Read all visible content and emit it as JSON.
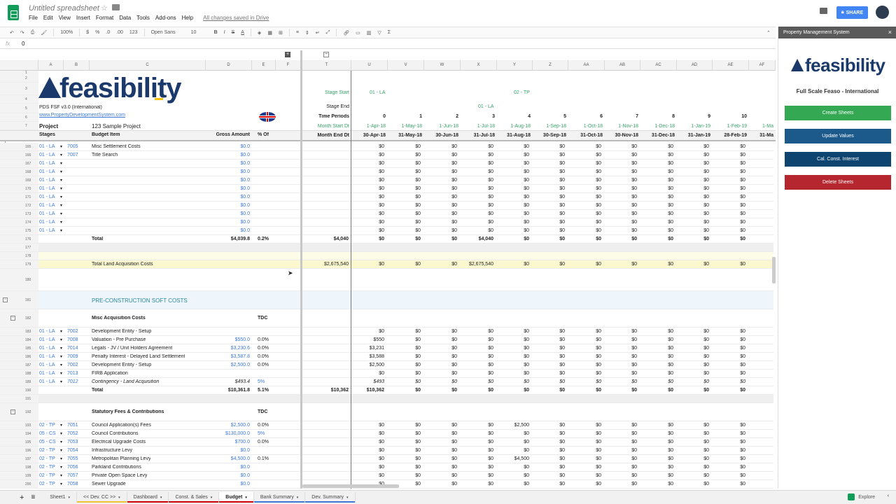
{
  "app": {
    "title": "Untitled spreadsheet",
    "menus": [
      "File",
      "Edit",
      "View",
      "Insert",
      "Format",
      "Data",
      "Tools",
      "Add-ons",
      "Help"
    ],
    "saved": "All changes saved in Drive",
    "share": "SHARE"
  },
  "toolbar": {
    "zoom": "100%",
    "currency": "$",
    "percent": "%",
    "dec_less": ".0",
    "dec_more": ".00",
    "format": "123",
    "font": "Open Sans",
    "size": "10",
    "bold": "B",
    "italic": "I",
    "strike": "S",
    "text_color": "A",
    "sigma": "Σ"
  },
  "formula": {
    "fx": "fx",
    "value": "0"
  },
  "columns": {
    "A": "A",
    "B": "B",
    "C": "C",
    "D": "D",
    "E": "E",
    "F": "F",
    "T": "T",
    "U": "U",
    "V": "V",
    "W": "W",
    "X": "X",
    "Y": "Y",
    "Z": "Z",
    "AA": "AA",
    "AB": "AB",
    "AC": "AC",
    "AD": "AD",
    "AE": "AE",
    "AF": "AF"
  },
  "header": {
    "logo": "feasibility",
    "version": "PDS FSF v3.0 (International)",
    "website": "www.PropertyDevelopmentSystem.com",
    "project_label": "Project",
    "project_value": "123 Sample Project",
    "stages": "Stages",
    "budget_item": "Budget Item",
    "gross_amount": "Gross Amount",
    "pct_of": "% Of",
    "stage_start": "Stage Start",
    "stage_end": "Stage End",
    "time_periods": "Time Periods",
    "month_start": "Month Start Dt",
    "month_end": "Month End Dt",
    "stage_start_la": "01 - LA",
    "stage_start_tp": "02 - TP",
    "stage_end_la": "01 - LA",
    "periods": [
      "0",
      "1",
      "2",
      "3",
      "4",
      "5",
      "6",
      "7",
      "8",
      "9",
      "10"
    ],
    "starts": [
      "1-Apr-18",
      "1-May-18",
      "1-Jun-18",
      "1-Jul-18",
      "1-Aug-18",
      "1-Sep-18",
      "1-Oct-18",
      "1-Nov-18",
      "1-Dec-18",
      "1-Jan-19",
      "1-Feb-19",
      "1-Ma"
    ],
    "ends": [
      "30-Apr-18",
      "31-May-18",
      "30-Jun-18",
      "31-Jul-18",
      "31-Aug-18",
      "30-Sep-18",
      "31-Oct-18",
      "30-Nov-18",
      "31-Dec-18",
      "31-Jan-19",
      "28-Feb-19",
      "31-Ma"
    ],
    "row_nums": [
      "1",
      "2",
      "3",
      "4",
      "5",
      "6",
      "7"
    ]
  },
  "rows": [
    {
      "n": "165",
      "stage": "01 - LA",
      "code": "7005",
      "item": "Misc Settlement Costs",
      "gross": "$0.0",
      "pct": "",
      "t": "",
      "vals": [
        "$0",
        "$0",
        "$0",
        "$0",
        "$0",
        "$0",
        "$0",
        "$0",
        "$0",
        "$0",
        "$0"
      ]
    },
    {
      "n": "166",
      "stage": "01 - LA",
      "code": "7007",
      "item": "Title Search",
      "gross": "$0.0",
      "pct": "",
      "t": "",
      "vals": [
        "$0",
        "$0",
        "$0",
        "$0",
        "$0",
        "$0",
        "$0",
        "$0",
        "$0",
        "$0",
        "$0"
      ]
    },
    {
      "n": "167",
      "stage": "01 - LA",
      "code": "",
      "item": "",
      "gross": "$0.0",
      "pct": "",
      "t": "",
      "vals": [
        "$0",
        "$0",
        "$0",
        "$0",
        "$0",
        "$0",
        "$0",
        "$0",
        "$0",
        "$0",
        "$0"
      ]
    },
    {
      "n": "168",
      "stage": "01 - LA",
      "code": "",
      "item": "",
      "gross": "$0.0",
      "pct": "",
      "t": "",
      "vals": [
        "$0",
        "$0",
        "$0",
        "$0",
        "$0",
        "$0",
        "$0",
        "$0",
        "$0",
        "$0",
        "$0"
      ]
    },
    {
      "n": "169",
      "stage": "01 - LA",
      "code": "",
      "item": "",
      "gross": "$0.0",
      "pct": "",
      "t": "",
      "vals": [
        "$0",
        "$0",
        "$0",
        "$0",
        "$0",
        "$0",
        "$0",
        "$0",
        "$0",
        "$0",
        "$0"
      ]
    },
    {
      "n": "170",
      "stage": "01 - LA",
      "code": "",
      "item": "",
      "gross": "$0.0",
      "pct": "",
      "t": "",
      "vals": [
        "$0",
        "$0",
        "$0",
        "$0",
        "$0",
        "$0",
        "$0",
        "$0",
        "$0",
        "$0",
        "$0"
      ]
    },
    {
      "n": "171",
      "stage": "01 - LA",
      "code": "",
      "item": "",
      "gross": "$0.0",
      "pct": "",
      "t": "",
      "vals": [
        "$0",
        "$0",
        "$0",
        "$0",
        "$0",
        "$0",
        "$0",
        "$0",
        "$0",
        "$0",
        "$0"
      ]
    },
    {
      "n": "172",
      "stage": "01 - LA",
      "code": "",
      "item": "",
      "gross": "$0.0",
      "pct": "",
      "t": "",
      "vals": [
        "$0",
        "$0",
        "$0",
        "$0",
        "$0",
        "$0",
        "$0",
        "$0",
        "$0",
        "$0",
        "$0"
      ]
    },
    {
      "n": "173",
      "stage": "01 - LA",
      "code": "",
      "item": "",
      "gross": "$0.0",
      "pct": "",
      "t": "",
      "vals": [
        "$0",
        "$0",
        "$0",
        "$0",
        "$0",
        "$0",
        "$0",
        "$0",
        "$0",
        "$0",
        "$0"
      ]
    },
    {
      "n": "174",
      "stage": "01 - LA",
      "code": "",
      "item": "",
      "gross": "$0.0",
      "pct": "",
      "t": "",
      "vals": [
        "$0",
        "$0",
        "$0",
        "$0",
        "$0",
        "$0",
        "$0",
        "$0",
        "$0",
        "$0",
        "$0"
      ]
    },
    {
      "n": "175",
      "stage": "01 - LA",
      "code": "",
      "item": "",
      "gross": "$0.0",
      "pct": "",
      "t": "",
      "vals": [
        "$0",
        "$0",
        "$0",
        "$0",
        "$0",
        "$0",
        "$0",
        "$0",
        "$0",
        "$0",
        "$0"
      ]
    },
    {
      "n": "176",
      "stage": "",
      "code": "",
      "item": "Total",
      "gross": "$4,039.8",
      "pct": "0.2%",
      "t": "$4,040",
      "vals": [
        "$0",
        "$0",
        "$0",
        "$4,040",
        "$0",
        "$0",
        "$0",
        "$0",
        "$0",
        "$0",
        "$0"
      ],
      "bold": true
    },
    {
      "n": "177",
      "stage": "",
      "code": "",
      "item": "",
      "gross": "",
      "pct": "",
      "t": "",
      "vals": [],
      "shade": "#efefef"
    },
    {
      "n": "178",
      "stage": "",
      "code": "",
      "item": "",
      "gross": "",
      "pct": "",
      "t": "",
      "vals": [],
      "shade": "#fdfde7"
    },
    {
      "n": "179",
      "stage": "",
      "code": "",
      "item": "Total Land Acquisition Costs",
      "gross": "",
      "pct": "",
      "t": "$2,675,540",
      "vals": [
        "$0",
        "$0",
        "$0",
        "$2,675,540",
        "$0",
        "$0",
        "$0",
        "$0",
        "$0",
        "$0",
        "$0"
      ],
      "shade": "#fbf8d0"
    },
    {
      "n": "180",
      "stage": "",
      "code": "",
      "item": "",
      "gross": "",
      "pct": "",
      "t": "",
      "vals": [],
      "h": 32
    },
    {
      "n": "181",
      "stage": "",
      "code": "",
      "item": "PRE-CONSTRUCTION SOFT COSTS",
      "gross": "",
      "pct": "",
      "t": "",
      "vals": [],
      "h": 26,
      "shade": "#eef5fb",
      "teal": true
    },
    {
      "n": "182",
      "stage": "",
      "code": "",
      "item": "Misc Acquisition Costs",
      "gross": "",
      "pct": "TDC",
      "t": "",
      "vals": [],
      "h": 26,
      "bold": true
    },
    {
      "n": "183",
      "stage": "01 - LA",
      "code": "7002",
      "item": "Development Entity - Setup",
      "gross": "",
      "pct": "",
      "t": "",
      "vals": [
        "$0",
        "$0",
        "$0",
        "$0",
        "$0",
        "$0",
        "$0",
        "$0",
        "$0",
        "$0",
        "$0"
      ]
    },
    {
      "n": "184",
      "stage": "01 - LA",
      "code": "7008",
      "item": "Valuation - Pre Purchase",
      "gross": "$550.0",
      "pct": "0.0%",
      "t": "",
      "vals": [
        "$550",
        "$0",
        "$0",
        "$0",
        "$0",
        "$0",
        "$0",
        "$0",
        "$0",
        "$0",
        "$0"
      ]
    },
    {
      "n": "185",
      "stage": "01 - LA",
      "code": "7014",
      "item": "Legals - JV / Unit Holders Agreement",
      "gross": "$3,230.6",
      "pct": "0.0%",
      "t": "",
      "vals": [
        "$3,231",
        "$0",
        "$0",
        "$0",
        "$0",
        "$0",
        "$0",
        "$0",
        "$0",
        "$0",
        "$0"
      ]
    },
    {
      "n": "186",
      "stage": "01 - LA",
      "code": "7009",
      "item": "Penalty Interest - Delayed Land Settlement",
      "gross": "$3,587.8",
      "pct": "0.0%",
      "t": "",
      "vals": [
        "$3,588",
        "$0",
        "$0",
        "$0",
        "$0",
        "$0",
        "$0",
        "$0",
        "$0",
        "$0",
        "$0"
      ]
    },
    {
      "n": "187",
      "stage": "01 - LA",
      "code": "7002",
      "item": "Development Entity - Setup",
      "gross": "$2,500.0",
      "pct": "0.0%",
      "t": "",
      "vals": [
        "$2,500",
        "$0",
        "$0",
        "$0",
        "$0",
        "$0",
        "$0",
        "$0",
        "$0",
        "$0",
        "$0"
      ]
    },
    {
      "n": "188",
      "stage": "01 - LA",
      "code": "7013",
      "item": "FIRB Application",
      "gross": "",
      "pct": "",
      "t": "",
      "vals": [
        "$0",
        "$0",
        "$0",
        "$0",
        "$0",
        "$0",
        "$0",
        "$0",
        "$0",
        "$0",
        "$0"
      ]
    },
    {
      "n": "189",
      "stage": "01 - LA",
      "code": "7012",
      "item": "Contingency - Land Acquisition",
      "gross": "$493.4",
      "pct": "5%",
      "t": "",
      "vals": [
        "$493",
        "$0",
        "$0",
        "$0",
        "$0",
        "$0",
        "$0",
        "$0",
        "$0",
        "$0",
        "$0"
      ],
      "italic": true
    },
    {
      "n": "190",
      "stage": "",
      "code": "",
      "item": "Total",
      "gross": "$10,361.8",
      "pct": "5.1%",
      "t": "$10,362",
      "vals": [
        "$10,362",
        "$0",
        "$0",
        "$0",
        "$0",
        "$0",
        "$0",
        "$0",
        "$0",
        "$0",
        "$0"
      ],
      "bold": true
    },
    {
      "n": "191",
      "stage": "",
      "code": "",
      "item": "",
      "gross": "",
      "pct": "",
      "t": "",
      "vals": [],
      "shade": "#efefef"
    },
    {
      "n": "192",
      "stage": "",
      "code": "",
      "item": "Statutory Fees & Contributions",
      "gross": "",
      "pct": "TDC",
      "t": "",
      "vals": [],
      "h": 26,
      "bold": true
    },
    {
      "n": "193",
      "stage": "02 - TP",
      "code": "7051",
      "item": "Council Application(s) Fees",
      "gross": "$2,500.0",
      "pct": "0.0%",
      "t": "",
      "vals": [
        "$0",
        "$0",
        "$0",
        "$0",
        "$2,500",
        "$0",
        "$0",
        "$0",
        "$0",
        "$0",
        "$0"
      ]
    },
    {
      "n": "194",
      "stage": "05 - CS",
      "code": "7052",
      "item": "Council Contributions",
      "gross": "$130,000.0",
      "pct": "5%",
      "t": "",
      "vals": [
        "$0",
        "$0",
        "$0",
        "$0",
        "$0",
        "$0",
        "$0",
        "$0",
        "$0",
        "$0",
        "$0"
      ]
    },
    {
      "n": "195",
      "stage": "05 - CS",
      "code": "7053",
      "item": "Electrical Upgrade Costs",
      "gross": "$700.0",
      "pct": "0.0%",
      "t": "",
      "vals": [
        "$0",
        "$0",
        "$0",
        "$0",
        "$0",
        "$0",
        "$0",
        "$0",
        "$0",
        "$0",
        "$0"
      ]
    },
    {
      "n": "196",
      "stage": "02 - TP",
      "code": "7054",
      "item": "Infrastructure Levy",
      "gross": "$0.0",
      "pct": "",
      "t": "",
      "vals": [
        "$0",
        "$0",
        "$0",
        "$0",
        "$0",
        "$0",
        "$0",
        "$0",
        "$0",
        "$0",
        "$0"
      ]
    },
    {
      "n": "197",
      "stage": "02 - TP",
      "code": "7055",
      "item": "Metropolitan Planning Levy",
      "gross": "$4,500.0",
      "pct": "0.1%",
      "t": "",
      "vals": [
        "$0",
        "$0",
        "$0",
        "$0",
        "$4,500",
        "$0",
        "$0",
        "$0",
        "$0",
        "$0",
        "$0"
      ]
    },
    {
      "n": "198",
      "stage": "02 - TP",
      "code": "7056",
      "item": "Parkland Contributions",
      "gross": "$0.0",
      "pct": "",
      "t": "",
      "vals": [
        "$0",
        "$0",
        "$0",
        "$0",
        "$0",
        "$0",
        "$0",
        "$0",
        "$0",
        "$0",
        "$0"
      ]
    },
    {
      "n": "199",
      "stage": "02 - TP",
      "code": "7057",
      "item": "Private Open Space Levy",
      "gross": "$0.0",
      "pct": "",
      "t": "",
      "vals": [
        "$0",
        "$0",
        "$0",
        "$0",
        "$0",
        "$0",
        "$0",
        "$0",
        "$0",
        "$0",
        "$0"
      ]
    },
    {
      "n": "200",
      "stage": "02 - TP",
      "code": "7058",
      "item": "Sewer Upgrade",
      "gross": "$0.0",
      "pct": "",
      "t": "",
      "vals": [
        "$0",
        "$0",
        "$0",
        "$0",
        "$0",
        "$0",
        "$0",
        "$0",
        "$0",
        "$0",
        "$0"
      ]
    }
  ],
  "sidebar": {
    "title": "Property Management System",
    "close": "×",
    "logo": "feasibility",
    "subtitle": "Full Scale Feaso - International",
    "buttons": [
      {
        "label": "Create Sheets",
        "color": "#34a853"
      },
      {
        "label": "Update Values",
        "color": "#1c5a8c"
      },
      {
        "label": "Cal. Const. Interest",
        "color": "#0e4470"
      },
      {
        "label": "Delete Sheets",
        "color": "#b5262e"
      }
    ]
  },
  "tabs": [
    {
      "label": "Sheet1",
      "color": ""
    },
    {
      "label": "<< Dev. CC >>",
      "color": "#f1c232"
    },
    {
      "label": "Dashboard",
      "color": "#cc0000"
    },
    {
      "label": "Const. & Sales",
      "color": "#cc0000"
    },
    {
      "label": "Budget",
      "color": "#cc0000",
      "active": true
    },
    {
      "label": "Bank Summary",
      "color": "#3c78d8"
    },
    {
      "label": "Dev. Summary",
      "color": "#3c78d8"
    }
  ],
  "explore": "Explore"
}
